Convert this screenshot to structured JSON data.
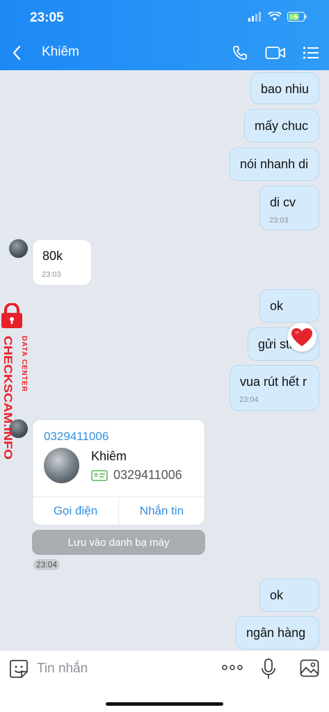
{
  "status_bar": {
    "time": "23:05"
  },
  "header": {
    "contact_name": "Khiêm"
  },
  "messages": {
    "m1": {
      "text": "bao nhiu"
    },
    "m2": {
      "text": "mấy chuc"
    },
    "m3": {
      "text": "nói nhanh di"
    },
    "m4": {
      "text": "di cv",
      "time": "23:03"
    },
    "m5": {
      "text": "80k",
      "time": "23:03"
    },
    "m6": {
      "text": "ok"
    },
    "m7": {
      "text": "gửi stk"
    },
    "m8": {
      "text": "vua rút hết r",
      "time": "23:04"
    },
    "m9": {
      "text": "ok"
    },
    "m10": {
      "text": "ngân hàng"
    }
  },
  "contact_card": {
    "phone_header": "0329411006",
    "name": "Khiêm",
    "phone": "0329411006",
    "call_label": "Gọi điện",
    "message_label": "Nhắn tin",
    "save_label": "Lưu vào danh bạ máy",
    "time": "23:04"
  },
  "watermark": {
    "line1": "DATA CENTER",
    "line2": "CHECKSCAM.INFO",
    "color": "#e8202a"
  },
  "composer": {
    "placeholder": "Tin nhắn"
  },
  "colors": {
    "accent": "#2f8fe0",
    "header": "#1e88f5",
    "outgoing": "#d5ebfb",
    "incoming": "#ffffff"
  }
}
